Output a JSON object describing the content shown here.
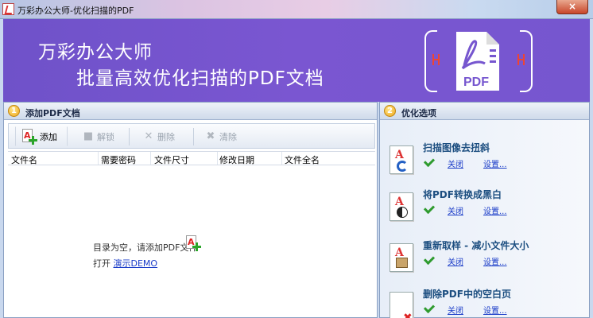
{
  "window": {
    "title": "万彩办公大师-优化扫描的PDF",
    "close_glyph": "×"
  },
  "banner": {
    "line1": "万彩办公大师",
    "line2": "批量高效优化扫描的PDF文档",
    "logo_text": "PDF"
  },
  "left_panel": {
    "step": "1",
    "title": "添加PDF文档",
    "toolbar": {
      "add": "添加",
      "decrypt": "解锁",
      "delete": "删除",
      "clear": "清除"
    },
    "columns": [
      "文件名",
      "需要密码",
      "文件尺寸",
      "修改日期",
      "文件全名"
    ],
    "empty_hint": "目录为空，请添加PDF文件",
    "open_label": "打开",
    "demo_link": "演示DEMO"
  },
  "right_panel": {
    "step": "2",
    "title": "优化选项",
    "options": [
      {
        "title": "扫描图像去扭斜",
        "link_off": "关闭",
        "link_settings": "设置..."
      },
      {
        "title": "将PDF转换成黑白",
        "link_off": "关闭",
        "link_settings": "设置..."
      },
      {
        "title": "重新取样 - 减小文件大小",
        "link_off": "关闭",
        "link_settings": "设置..."
      },
      {
        "title": "删除PDF中的空白页",
        "link_off": "关闭",
        "link_settings": "设置..."
      }
    ]
  },
  "colors": {
    "banner": "#7454cf",
    "accent_link": "#1a3cc8",
    "option_title": "#1c4e80"
  }
}
